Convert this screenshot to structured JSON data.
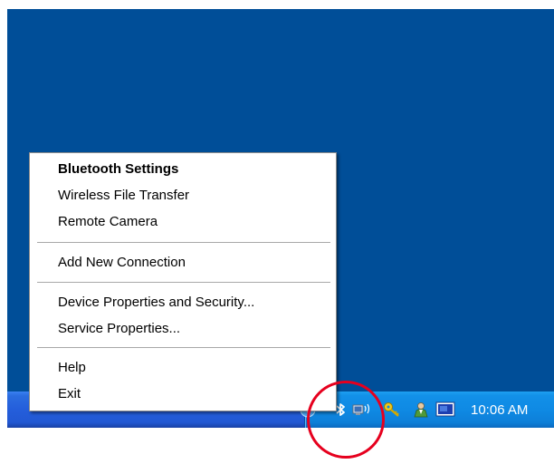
{
  "menu": {
    "items": [
      {
        "label": "Bluetooth Settings",
        "bold": true
      },
      {
        "label": "Wireless File Transfer",
        "bold": false
      },
      {
        "label": "Remote Camera",
        "bold": false
      },
      {
        "label": "Add New Connection",
        "bold": false
      },
      {
        "label": "Device Properties and Security...",
        "bold": false
      },
      {
        "label": "Service Properties...",
        "bold": false
      },
      {
        "label": "Help",
        "bold": false
      },
      {
        "label": "Exit",
        "bold": false
      }
    ]
  },
  "tray": {
    "icons": [
      "chevron-left-icon",
      "bluetooth-icon",
      "wireless-network-icon",
      "key-icon",
      "user-icon",
      "monitor-icon"
    ],
    "clock": "10:06 AM"
  },
  "colors": {
    "desktop": "#004e98",
    "taskbar": "#245edb",
    "tray": "#0f8ae4",
    "annotation": "#e6001e"
  }
}
